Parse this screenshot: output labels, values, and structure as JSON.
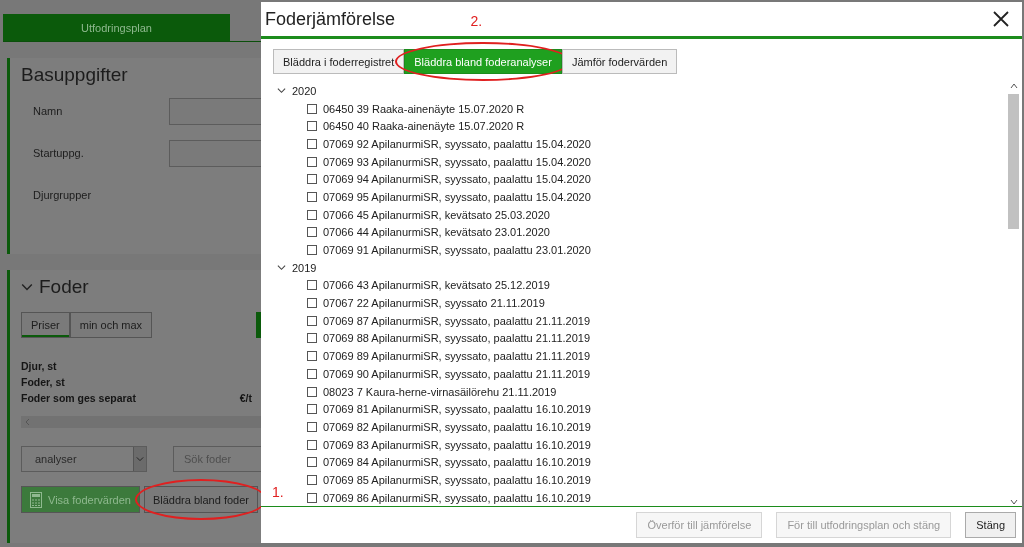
{
  "page": {
    "tabs": [
      {
        "label": "Utfodringsplan",
        "selected": true
      }
    ],
    "basuppgifter": {
      "title": "Basuppgifter",
      "fields": [
        {
          "label": "Namn",
          "kind": "input"
        },
        {
          "label": "Startuppg.",
          "kind": "input"
        },
        {
          "label": "Djurgrupper",
          "kind": "text"
        }
      ]
    },
    "foder": {
      "title": "Foder",
      "expanded": true,
      "tabs": [
        {
          "label": "Priser",
          "selected": true
        },
        {
          "label": "min och max",
          "selected": false
        }
      ],
      "summary_rows": [
        {
          "label": "Djur, st"
        },
        {
          "label": "Foder, st"
        },
        {
          "label": "Foder som ges separat",
          "unit": "€/t"
        }
      ],
      "dropdown": {
        "value": "analyser"
      },
      "search": {
        "placeholder": "Sök foder"
      },
      "buttons": [
        {
          "label": "Visa fodervärden",
          "kind": "primary",
          "circled": false
        },
        {
          "label": "Bläddra bland foder",
          "kind": "secondary",
          "circled": true,
          "annotation": "1."
        }
      ]
    }
  },
  "dialog": {
    "title": "Foderjämförelse",
    "tabs": [
      {
        "label": "Bläddra i foderregistret",
        "selected": false,
        "circled": false
      },
      {
        "label": "Bläddra bland foderanalyser",
        "selected": true,
        "circled": true,
        "annotation": "2."
      },
      {
        "label": "Jämför fodervärden",
        "selected": false,
        "circled": false
      }
    ],
    "tree": [
      {
        "label": "2020",
        "expanded": true,
        "children": [
          {
            "label": "06450 39 Raaka-ainenäyte 15.07.2020 R",
            "checked": false
          },
          {
            "label": "06450 40 Raaka-ainenäyte 15.07.2020 R",
            "checked": false
          },
          {
            "label": "07069 92 ApilanurmiSR, syyssato, paalattu 15.04.2020",
            "checked": false
          },
          {
            "label": "07069 93 ApilanurmiSR, syyssato, paalattu 15.04.2020",
            "checked": false
          },
          {
            "label": "07069 94 ApilanurmiSR, syyssato, paalattu 15.04.2020",
            "checked": false
          },
          {
            "label": "07069 95 ApilanurmiSR, syyssato, paalattu 15.04.2020",
            "checked": false
          },
          {
            "label": "07066 45 ApilanurmiSR, kevätsato 25.03.2020",
            "checked": false
          },
          {
            "label": "07066 44 ApilanurmiSR, kevätsato 23.01.2020",
            "checked": false
          },
          {
            "label": "07069 91 ApilanurmiSR, syyssato, paalattu 23.01.2020",
            "checked": false
          }
        ]
      },
      {
        "label": "2019",
        "expanded": true,
        "children": [
          {
            "label": "07066 43 ApilanurmiSR, kevätsato 25.12.2019",
            "checked": false
          },
          {
            "label": "07067 22 ApilanurmiSR, syyssato 21.11.2019",
            "checked": false
          },
          {
            "label": "07069 87 ApilanurmiSR, syyssato, paalattu 21.11.2019",
            "checked": false
          },
          {
            "label": "07069 88 ApilanurmiSR, syyssato, paalattu 21.11.2019",
            "checked": false
          },
          {
            "label": "07069 89 ApilanurmiSR, syyssato, paalattu 21.11.2019",
            "checked": false
          },
          {
            "label": "07069 90 ApilanurmiSR, syyssato, paalattu 21.11.2019",
            "checked": false
          },
          {
            "label": "08023 7 Kaura-herne-virnasäilörehu 21.11.2019",
            "checked": false
          },
          {
            "label": "07069 81 ApilanurmiSR, syyssato, paalattu 16.10.2019",
            "checked": false
          },
          {
            "label": "07069 82 ApilanurmiSR, syyssato, paalattu 16.10.2019",
            "checked": false
          },
          {
            "label": "07069 83 ApilanurmiSR, syyssato, paalattu 16.10.2019",
            "checked": false
          },
          {
            "label": "07069 84 ApilanurmiSR, syyssato, paalattu 16.10.2019",
            "checked": false
          },
          {
            "label": "07069 85 ApilanurmiSR, syyssato, paalattu 16.10.2019",
            "checked": false
          },
          {
            "label": "07069 86 ApilanurmiSR, syyssato, paalattu 16.10.2019",
            "checked": false
          }
        ]
      }
    ],
    "footer_buttons": [
      {
        "label": "Överför till jämförelse",
        "disabled": true
      },
      {
        "label": "För till utfodringsplan och stäng",
        "disabled": true
      },
      {
        "label": "Stäng",
        "disabled": false
      }
    ]
  }
}
